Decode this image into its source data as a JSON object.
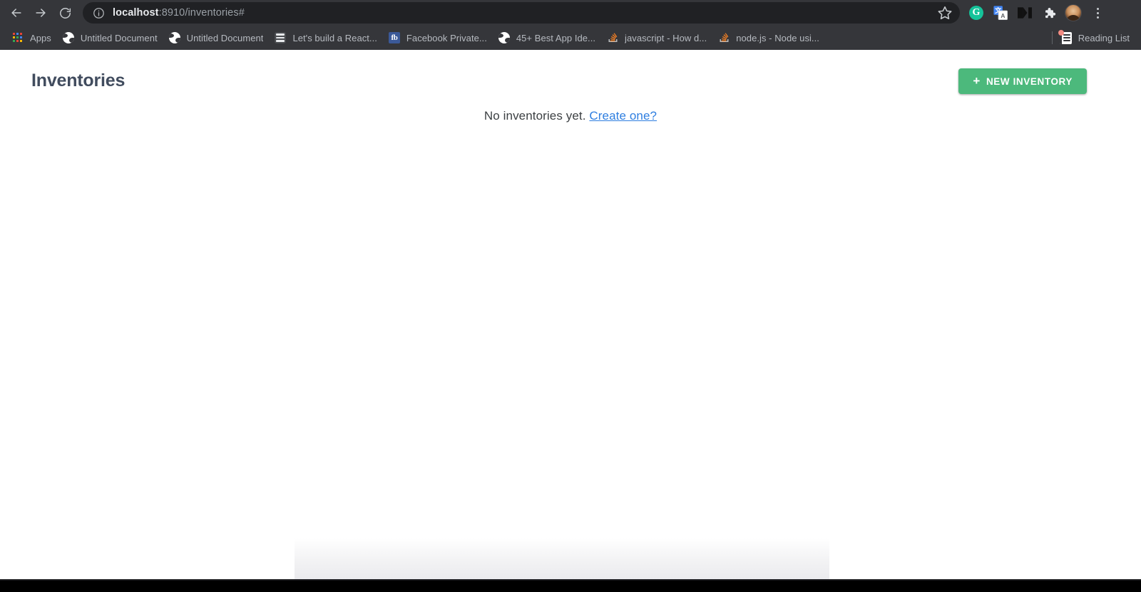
{
  "browser": {
    "nav": {
      "back_title": "Back",
      "forward_title": "Forward",
      "reload_title": "Reload"
    },
    "omnibox": {
      "info_icon": "info-circle-icon",
      "host": "localhost",
      "path": ":8910/inventories#",
      "full_url": "localhost:8910/inventories#",
      "star_icon": "bookmark-star-icon"
    },
    "extensions": [
      {
        "name": "grammarly-extension",
        "icon": "grammarly-icon",
        "glyph": "G",
        "color": "#15c39a"
      },
      {
        "name": "google-translate-extension",
        "icon": "google-translate-icon",
        "color": "#4285f4"
      },
      {
        "name": "medium-extension",
        "icon": "medium-icon",
        "color": "#111111"
      },
      {
        "name": "extensions-menu",
        "icon": "puzzle-piece-icon",
        "color": "#e8eaed"
      }
    ],
    "profile": {
      "name": "profile-avatar",
      "icon": "avatar-icon"
    },
    "menu": {
      "name": "chrome-menu",
      "icon": "kebab-menu-icon"
    },
    "bookmarks": [
      {
        "label": "Apps",
        "icon": "apps-grid-icon"
      },
      {
        "label": "Untitled Document",
        "icon": "globe-icon"
      },
      {
        "label": "Untitled Document",
        "icon": "globe-icon"
      },
      {
        "label": "Let's build a React...",
        "icon": "list-page-icon"
      },
      {
        "label": "Facebook Private...",
        "icon": "facebook-icon",
        "glyph": "fb"
      },
      {
        "label": "45+ Best App Ide...",
        "icon": "globe-icon"
      },
      {
        "label": "javascript - How d...",
        "icon": "stack-overflow-icon"
      },
      {
        "label": "node.js - Node usi...",
        "icon": "stack-overflow-icon"
      }
    ],
    "reading_list": {
      "label": "Reading List",
      "icon": "reading-list-icon",
      "badge_color": "#f28b82"
    }
  },
  "page": {
    "title": "Inventories",
    "title_color": "#414c5e",
    "new_inventory": {
      "label": "NEW INVENTORY",
      "plus": "+",
      "color": "#4cb97c"
    },
    "empty_state": {
      "text": "No inventories yet.",
      "link_label": "Create one?",
      "link_color": "#2e7ee0"
    }
  }
}
